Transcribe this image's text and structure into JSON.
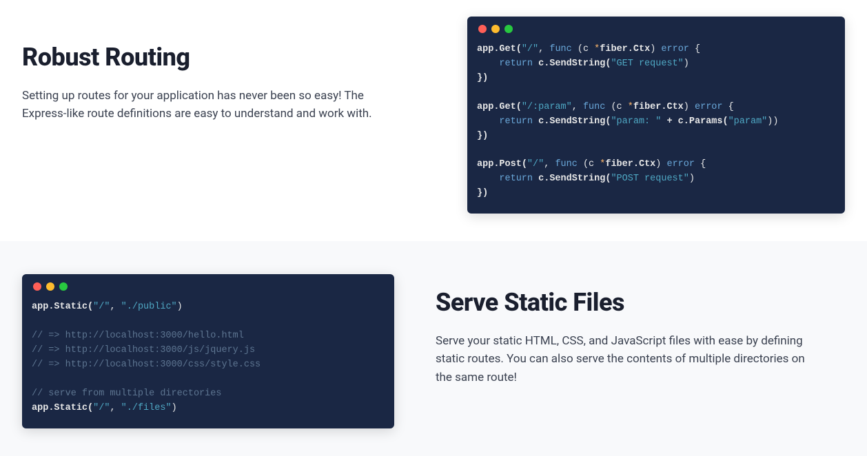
{
  "section1": {
    "heading": "Robust Routing",
    "desc": "Setting up routes for your application has never been so easy! The Express-like route definitions are easy to understand and work with.",
    "code": {
      "line1_a": "app",
      "line1_b": ".Get(",
      "line1_c": "\"/\"",
      "line1_d": ", ",
      "line1_e": "func",
      "line1_f": " (c ",
      "line1_g": "*",
      "line1_h": "fiber.Ctx",
      "line1_i": ") ",
      "line1_j": "error",
      "line1_k": " {",
      "line2_a": "    ",
      "line2_b": "return",
      "line2_c": " c.SendString(",
      "line2_d": "\"GET request\"",
      "line2_e": ")",
      "line3": "})",
      "line4": "",
      "line5_a": "app",
      "line5_b": ".Get(",
      "line5_c": "\"/:param\"",
      "line5_d": ", ",
      "line5_e": "func",
      "line5_f": " (c ",
      "line5_g": "*",
      "line5_h": "fiber.Ctx",
      "line5_i": ") ",
      "line5_j": "error",
      "line5_k": " {",
      "line6_a": "    ",
      "line6_b": "return",
      "line6_c": " c.SendString(",
      "line6_d": "\"param: \"",
      "line6_e": " + c.Params(",
      "line6_f": "\"param\"",
      "line6_g": "))",
      "line7": "})",
      "line8": "",
      "line9_a": "app",
      "line9_b": ".Post(",
      "line9_c": "\"/\"",
      "line9_d": ", ",
      "line9_e": "func",
      "line9_f": " (c ",
      "line9_g": "*",
      "line9_h": "fiber.Ctx",
      "line9_i": ") ",
      "line9_j": "error",
      "line9_k": " {",
      "line10_a": "    ",
      "line10_b": "return",
      "line10_c": " c.SendString(",
      "line10_d": "\"POST request\"",
      "line10_e": ")",
      "line11": "})"
    }
  },
  "section2": {
    "heading": "Serve Static Files",
    "desc": "Serve your static HTML, CSS, and JavaScript files with ease by defining static routes. You can also serve the contents of multiple directories on the same route!",
    "code": {
      "line1_a": "app",
      "line1_b": ".Static(",
      "line1_c": "\"/\"",
      "line1_d": ", ",
      "line1_e": "\"./public\"",
      "line1_f": ")",
      "line2": "",
      "line3": "// => http://localhost:3000/hello.html",
      "line4": "// => http://localhost:3000/js/jquery.js",
      "line5": "// => http://localhost:3000/css/style.css",
      "line6": "",
      "line7": "// serve from multiple directories",
      "line8_a": "app",
      "line8_b": ".Static(",
      "line8_c": "\"/\"",
      "line8_d": ", ",
      "line8_e": "\"./files\"",
      "line8_f": ")"
    }
  }
}
